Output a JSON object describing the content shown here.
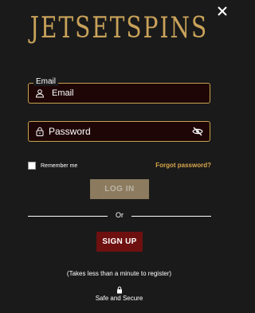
{
  "brand": {
    "logo_text": "JETSETSPINS",
    "accent_color": "#c7a14f"
  },
  "login": {
    "email": {
      "legend": "Email",
      "placeholder": "Email",
      "value": "",
      "icon": "user-icon"
    },
    "password": {
      "placeholder": "Password",
      "value": "",
      "icon": "lock-icon",
      "toggle_icon": "eye-slash-icon"
    },
    "remember_label": "Remember me",
    "remember_checked": false,
    "forgot_label": "Forgot password?",
    "login_button": "LOG IN",
    "divider_text": "Or",
    "signup_button": "SIGN UP",
    "note": "(Takes less than a minute to register)",
    "secure_label": "Safe and Secure"
  },
  "colors": {
    "background": "#1a1a1a",
    "field_background": "#1e0606",
    "login_button": "#a08c6a",
    "signup_button": "#6e1010",
    "link": "#d9a64a"
  }
}
